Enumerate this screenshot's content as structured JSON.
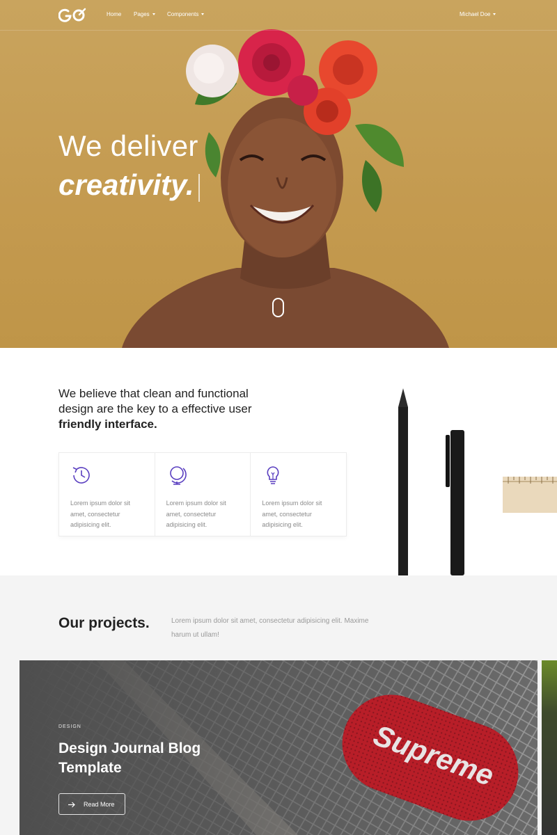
{
  "navbar": {
    "logo_text": "GO",
    "links": [
      {
        "label": "Home",
        "has_dropdown": false
      },
      {
        "label": "Pages",
        "has_dropdown": true
      },
      {
        "label": "Components",
        "has_dropdown": true
      }
    ],
    "user": {
      "label": "Michael Doe",
      "has_dropdown": true
    }
  },
  "hero": {
    "line1": "We deliver",
    "line2": "creativity.",
    "background_color": "#c59c52"
  },
  "about": {
    "text_plain": "We believe that clean and functional design are the key to a effective user ",
    "text_bold": "friendly interface.",
    "features": [
      {
        "icon": "clock-icon",
        "text": "Lorem ipsum dolor sit amet, consectetur adipisicing elit."
      },
      {
        "icon": "globe-icon",
        "text": "Lorem ipsum dolor sit amet, consectetur adipisicing elit."
      },
      {
        "icon": "lightbulb-icon",
        "text": "Lorem ipsum dolor sit amet, consectetur adipisicing elit."
      }
    ],
    "accent_color": "#5a3fc0"
  },
  "projects": {
    "title": "Our projects.",
    "description": "Lorem ipsum dolor sit amet, consectetur adipisicing elit. Maxime harum ut ullam!",
    "card": {
      "category": "DESIGN",
      "title": "Design Journal Blog Template",
      "button_label": "Read More",
      "product_text": "Supreme",
      "product_color": "#c0242e"
    }
  }
}
